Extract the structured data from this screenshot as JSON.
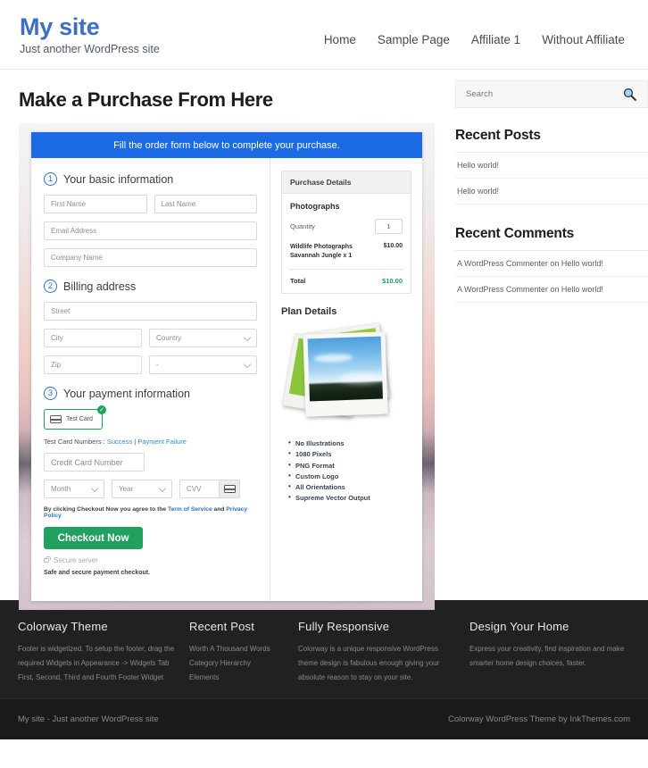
{
  "header": {
    "site_title": "My site",
    "tagline": "Just another WordPress site",
    "nav": [
      {
        "label": "Home"
      },
      {
        "label": "Sample Page"
      },
      {
        "label": "Affiliate 1"
      },
      {
        "label": "Without Affiliate"
      }
    ]
  },
  "main": {
    "page_title": "Make a Purchase From Here",
    "banner": "Fill the order form below to complete your purchase.",
    "section1": {
      "number": "1",
      "title": "Your basic information",
      "first_name_placeholder": "First Name",
      "last_name_placeholder": "Last Name",
      "email_placeholder": "Email Address",
      "company_placeholder": "Company Name"
    },
    "section2": {
      "number": "2",
      "title": "Billing address",
      "street_placeholder": "Street",
      "city_placeholder": "City",
      "country_placeholder": "Country",
      "zip_placeholder": "Zip",
      "state_placeholder": "-"
    },
    "section3": {
      "number": "3",
      "title": "Your payment information",
      "test_card_label": "Test Card",
      "test_card_badge": "✓",
      "test_numbers_prefix": "Test Card Numbers : ",
      "test_numbers_success": "Success",
      "test_numbers_divider": " | ",
      "test_numbers_failure": "Payment Failure",
      "card_number_placeholder": "Credit Card Number",
      "month_placeholder": "Month",
      "year_placeholder": "Year",
      "cvv_placeholder": "CVV",
      "agree_prefix": "By clicking Checkout Now you agree to the ",
      "agree_tos": "Term of Service",
      "agree_and": " and ",
      "agree_privacy": "Privacy Policy",
      "checkout_label": "Checkout Now",
      "secure_server": "Secure server",
      "safe_note": "Safe and secure payment checkout."
    },
    "purchase_details": {
      "heading": "Purchase Details",
      "product": "Photographs",
      "quantity_label": "Quantity",
      "quantity_value": "1",
      "line_item_name": "Wildlife Photographs Savannah Jungle x 1",
      "line_item_price": "$10.00",
      "total_label": "Total",
      "total_value": "$10.00"
    },
    "plan": {
      "title": "Plan Details",
      "features": [
        "No Illustrations",
        "1080 Pixels",
        "PNG Format",
        "Custom Logo",
        "All Orientations",
        "Supreme Vector Output"
      ]
    }
  },
  "sidebar": {
    "search_placeholder": "Search",
    "recent_posts_title": "Recent Posts",
    "recent_posts": [
      {
        "label": "Hello world!"
      },
      {
        "label": "Hello world!"
      }
    ],
    "recent_comments_title": "Recent Comments",
    "recent_comments": [
      {
        "label": "A WordPress Commenter on Hello world!"
      },
      {
        "label": "A WordPress Commenter on Hello world!"
      }
    ]
  },
  "footer": {
    "columns": [
      {
        "title": "Colorway Theme",
        "text": "Footer is widgetized. To setup the footer, drag the required Widgets in Appearance -> Widgets Tab First, Second, Third and Fourth Footer Widget"
      },
      {
        "title": "Recent Post",
        "items": [
          {
            "label": "Worth A Thousand Words"
          },
          {
            "label": "Category Hierarchy"
          },
          {
            "label": "Elements"
          }
        ]
      },
      {
        "title": "Fully Responsive",
        "text": "Colorway is a unique responsive WordPress theme design is fabulous enough giving your absolute reason to stay on your site."
      },
      {
        "title": "Design Your Home",
        "text": "Express your creativity, find inspiration and make smarter home design choices, faster."
      }
    ],
    "copyright_left": "My site - Just another WordPress site",
    "copyright_right": "Colorway WordPress Theme by InkThemes.com"
  },
  "colors": {
    "brand_blue": "#3c6fc4",
    "banner_blue": "#1c6ae4",
    "accent_green": "#22a05f",
    "link_blue": "#2f8fd8",
    "footer_dark": "#212121"
  }
}
